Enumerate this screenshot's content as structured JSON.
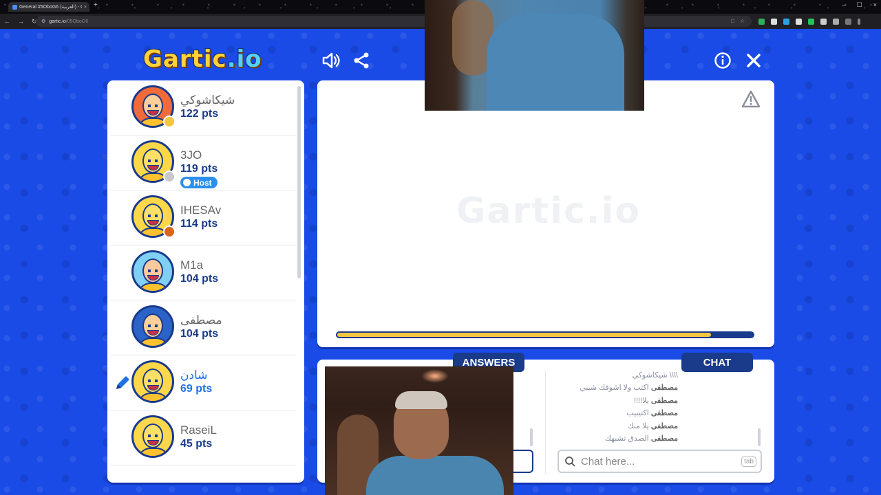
{
  "browser": {
    "tab_title": "General #5OboG6 (العربية) - Ga",
    "tab_close": "×",
    "new_tab": "+",
    "url_host": "gartic.io",
    "url_path": "/05OboG6",
    "window_controls": [
      "–",
      "☐",
      "×"
    ]
  },
  "logo": {
    "main": "Gartic",
    "suffix": ".io"
  },
  "watermark": "Gartic.io",
  "players": [
    {
      "name": "شيكاشوكي",
      "points": "122 pts",
      "status_color": "#f4c542",
      "host": false,
      "drawing": false,
      "avatar": "grandma"
    },
    {
      "name": "3JO",
      "points": "119 pts",
      "status_color": "#c7c9cf",
      "host": true,
      "drawing": false,
      "avatar": "default"
    },
    {
      "name": "IHESAv",
      "points": "114 pts",
      "status_color": "#d9661a",
      "host": false,
      "drawing": false,
      "avatar": "default"
    },
    {
      "name": "M1a",
      "points": "104 pts",
      "status_color": "",
      "host": false,
      "drawing": false,
      "avatar": "boy"
    },
    {
      "name": "مصطفى",
      "points": "104 pts",
      "status_color": "",
      "host": false,
      "drawing": false,
      "avatar": "bearded"
    },
    {
      "name": "شادن",
      "points": "69 pts",
      "status_color": "",
      "host": false,
      "drawing": true,
      "avatar": "default"
    },
    {
      "name": "RaseiL",
      "points": "45 pts",
      "status_color": "",
      "host": false,
      "drawing": false,
      "avatar": "default"
    }
  ],
  "host_label": "Host",
  "timer": {
    "remaining_fraction": 0.9
  },
  "panels": {
    "answers_label": "ANSWERS",
    "chat_label": "CHAT"
  },
  "chat": {
    "messages": [
      {
        "user": "",
        "text": "\\\\\\\\ شيكاشوكي"
      },
      {
        "user": "مصطفى",
        "text": "اكتب ولا اشوفك شيبي"
      },
      {
        "user": "مصطفى",
        "text": "يلا!!!!"
      },
      {
        "user": "مصطفى",
        "text": "اكتيبيب"
      },
      {
        "user": "مصطفى",
        "text": "يلا منك"
      },
      {
        "user": "مصطفى",
        "text": "الصدق تشبهك"
      }
    ],
    "placeholder": "Chat here...",
    "tab_hint": "tab"
  },
  "colors": {
    "background": "#1a4be6",
    "navy": "#1a3a8a",
    "accent": "#1f6fe6",
    "timer": "#f4c542"
  }
}
